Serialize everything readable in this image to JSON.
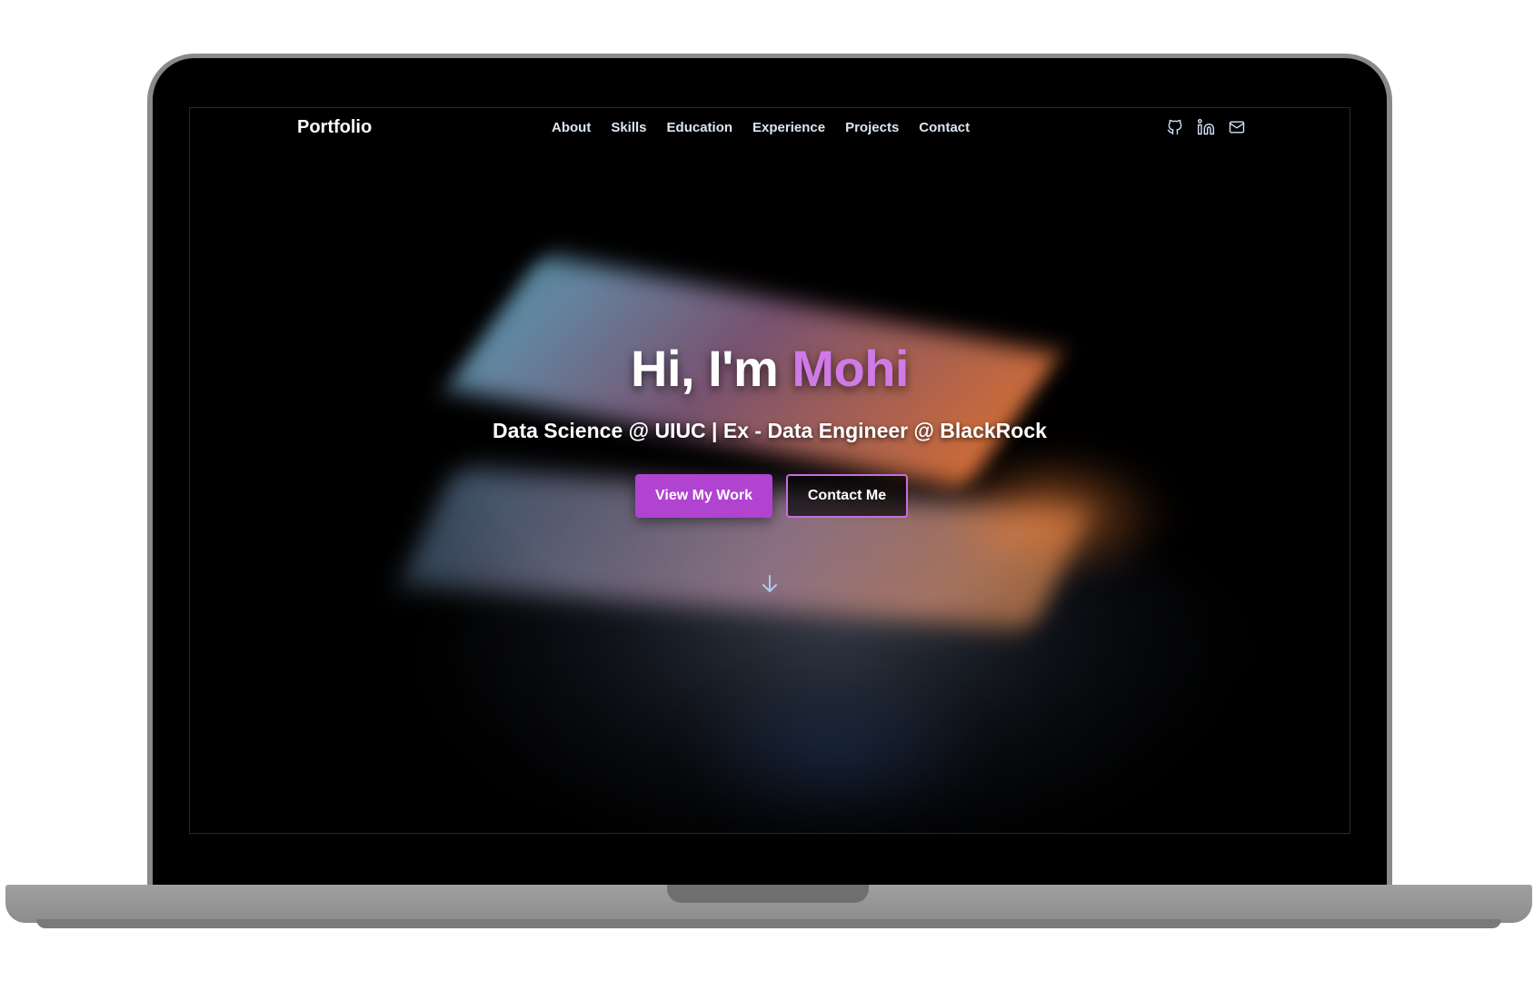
{
  "nav": {
    "brand": "Portfolio",
    "items": [
      {
        "label": "About"
      },
      {
        "label": "Skills"
      },
      {
        "label": "Education"
      },
      {
        "label": "Experience"
      },
      {
        "label": "Projects"
      },
      {
        "label": "Contact"
      }
    ],
    "socials": [
      {
        "icon": "github-icon"
      },
      {
        "icon": "linkedin-icon"
      },
      {
        "icon": "mail-icon"
      }
    ]
  },
  "hero": {
    "greeting": "Hi, I'm",
    "name": "Mohi",
    "subtitle": "Data Science @ UIUC | Ex - Data Engineer @ BlackRock",
    "primary_button": "View My Work",
    "secondary_button": "Contact Me",
    "scroll_icon": "arrow-down-icon"
  },
  "colors": {
    "accent": "#d07ae8",
    "primary_button": "#b043d0",
    "nav_text": "#dbe6f5",
    "background": "#000000"
  }
}
